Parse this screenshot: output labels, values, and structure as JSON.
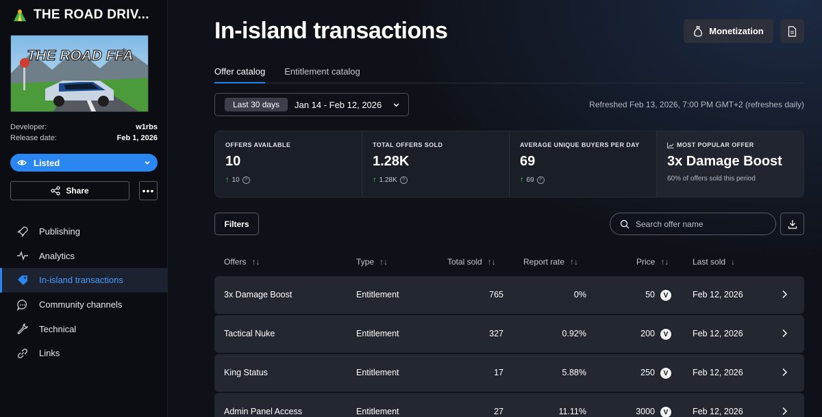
{
  "app": {
    "title": "THE ROAD DRIV...",
    "thumbnail_text": "THE ROAD FFA"
  },
  "meta": {
    "developer_label": "Developer:",
    "developer_value": "w1rbs",
    "release_label": "Release date:",
    "release_value": "Feb 1, 2026"
  },
  "status": {
    "label": "Listed"
  },
  "share": {
    "label": "Share"
  },
  "nav": [
    {
      "label": "Publishing",
      "icon": "rocket-icon"
    },
    {
      "label": "Analytics",
      "icon": "pulse-icon"
    },
    {
      "label": "In-island transactions",
      "icon": "tag-icon",
      "active": true
    },
    {
      "label": "Community channels",
      "icon": "chat-icon"
    },
    {
      "label": "Technical",
      "icon": "wrench-icon"
    },
    {
      "label": "Links",
      "icon": "link-icon"
    }
  ],
  "page": {
    "title": "In-island transactions"
  },
  "header": {
    "monetization_label": "Monetization"
  },
  "tabs": [
    {
      "label": "Offer catalog",
      "active": true
    },
    {
      "label": "Entitlement catalog"
    }
  ],
  "date_range": {
    "preset": "Last 30 days",
    "range": "Jan 14 - Feb 12, 2026"
  },
  "refreshed": "Refreshed Feb 13, 2026, 7:00 PM GMT+2 (refreshes daily)",
  "stats": [
    {
      "label": "OFFERS AVAILABLE",
      "value": "10",
      "delta": "10"
    },
    {
      "label": "TOTAL OFFERS SOLD",
      "value": "1.28K",
      "delta": "1.28K"
    },
    {
      "label": "AVERAGE UNIQUE BUYERS PER DAY",
      "value": "69",
      "delta": "69"
    },
    {
      "label": "MOST POPULAR OFFER",
      "value": "3x Damage Boost",
      "sub": "60% of offers sold this period"
    }
  ],
  "filters_label": "Filters",
  "search": {
    "placeholder": "Search offer name"
  },
  "table": {
    "columns": [
      "Offers",
      "Type",
      "Total sold",
      "Report rate",
      "Price",
      "Last sold"
    ],
    "rows": [
      {
        "offer": "3x Damage Boost",
        "type": "Entitlement",
        "total_sold": "765",
        "report_rate": "0%",
        "price": "50",
        "last_sold": "Feb 12, 2026"
      },
      {
        "offer": "Tactical Nuke",
        "type": "Entitlement",
        "total_sold": "327",
        "report_rate": "0.92%",
        "price": "200",
        "last_sold": "Feb 12, 2026"
      },
      {
        "offer": "King Status",
        "type": "Entitlement",
        "total_sold": "17",
        "report_rate": "5.88%",
        "price": "250",
        "last_sold": "Feb 12, 2026"
      },
      {
        "offer": "Admin Panel Access",
        "type": "Entitlement",
        "total_sold": "27",
        "report_rate": "11.11%",
        "price": "3000",
        "last_sold": "Feb 12, 2026"
      }
    ]
  },
  "currency_badge": "V",
  "colors": {
    "accent": "#2a86f0",
    "positive": "#3ecf6c",
    "background": "#0e1117",
    "row": "#23272f"
  }
}
